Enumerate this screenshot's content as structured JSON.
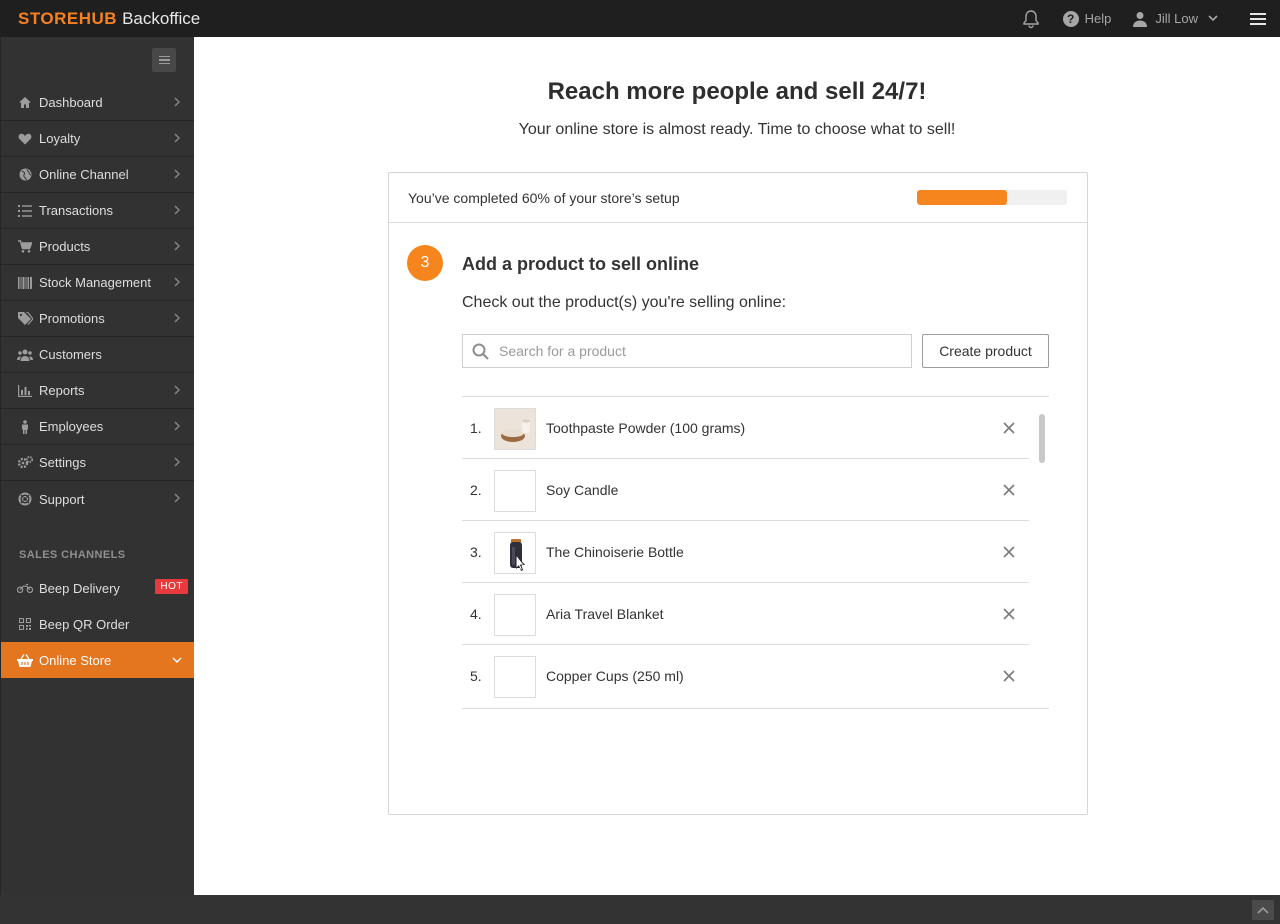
{
  "app": {
    "brand_logo": "STOREHUB",
    "brand_sub": "Backoffice",
    "help_label": "Help",
    "user_name": "Jill Low"
  },
  "sidebar": {
    "items": [
      {
        "label": "Dashboard",
        "icon": "home-icon"
      },
      {
        "label": "Loyalty",
        "icon": "heart-icon"
      },
      {
        "label": "Online Channel",
        "icon": "globe-icon"
      },
      {
        "label": "Transactions",
        "icon": "list-icon"
      },
      {
        "label": "Products",
        "icon": "cart-icon"
      },
      {
        "label": "Stock Management",
        "icon": "barcode-icon"
      },
      {
        "label": "Promotions",
        "icon": "tags-icon"
      },
      {
        "label": "Customers",
        "icon": "users-icon"
      },
      {
        "label": "Reports",
        "icon": "bar-chart-icon"
      },
      {
        "label": "Employees",
        "icon": "person-icon"
      },
      {
        "label": "Settings",
        "icon": "gears-icon"
      },
      {
        "label": "Support",
        "icon": "lifebuoy-icon"
      }
    ],
    "section_label": "SALES CHANNELS",
    "channels": [
      {
        "label": "Beep Delivery",
        "badge": "HOT",
        "icon": "motorcycle-icon"
      },
      {
        "label": "Beep QR Order",
        "icon": "qr-code-icon"
      },
      {
        "label": "Online Store",
        "icon": "basket-icon",
        "active": true
      }
    ]
  },
  "main": {
    "headline": "Reach more people and sell 24/7!",
    "subline": "Your online store is almost ready. Time to choose what to sell!",
    "progress": {
      "text": "You’ve completed 60% of your store’s setup",
      "percent": 60,
      "color": "#f7851e"
    },
    "step": {
      "number": "3",
      "title": "Add a product to sell online",
      "subtitle": "Check out the product(s) you're selling online:"
    },
    "search": {
      "placeholder": "Search for a product",
      "value": ""
    },
    "create_button": "Create product",
    "products": [
      {
        "num": "1.",
        "name": "Toothpaste Powder (100 grams)",
        "thumb": "powder-bowl"
      },
      {
        "num": "2.",
        "name": "Soy Candle",
        "thumb": "none"
      },
      {
        "num": "3.",
        "name": "The Chinoiserie Bottle",
        "thumb": "bottle"
      },
      {
        "num": "4.",
        "name": "Aria Travel Blanket",
        "thumb": "none"
      },
      {
        "num": "5.",
        "name": "Copper Cups (250 ml)",
        "thumb": "none"
      }
    ]
  },
  "colors": {
    "accent": "#f7851e",
    "sidebar_active": "#e4761f",
    "hot_badge": "#e83a3a"
  }
}
